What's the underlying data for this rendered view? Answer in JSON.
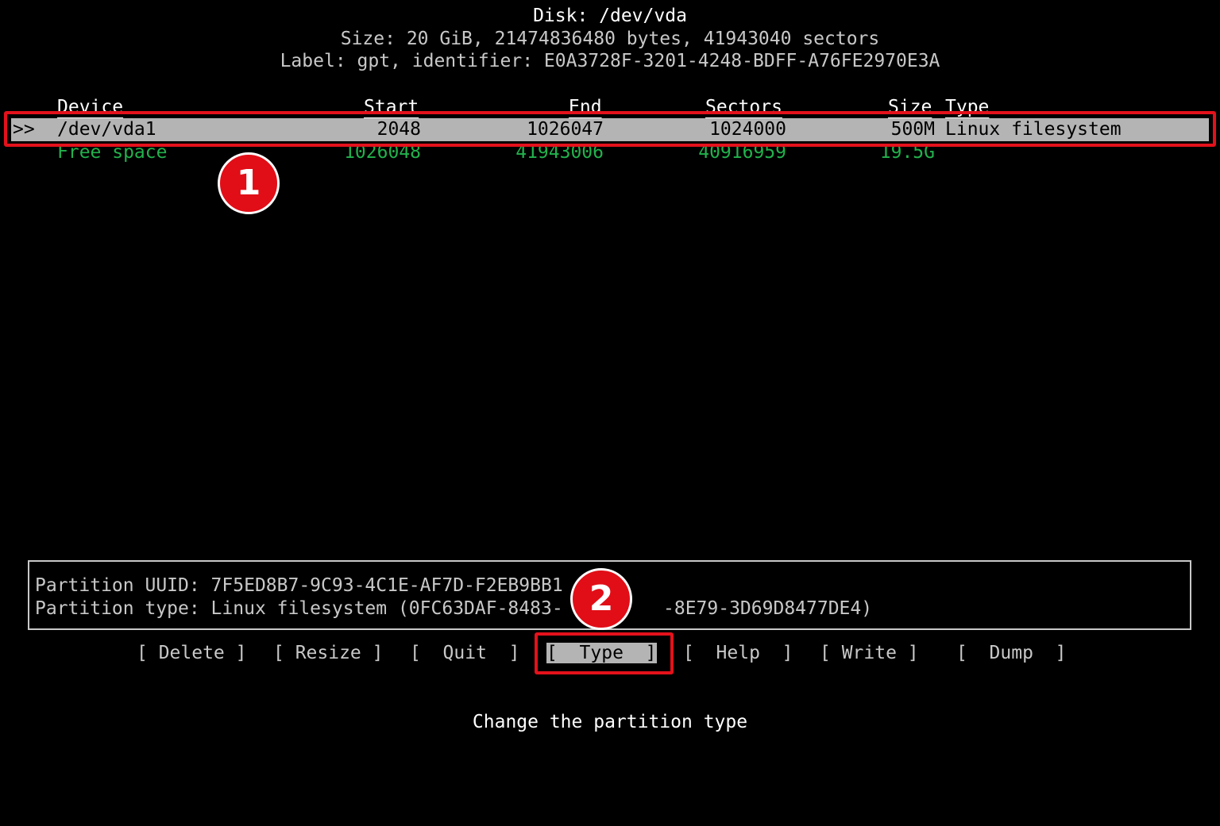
{
  "disk": {
    "title": "Disk: /dev/vda",
    "size_line": "Size: 20 GiB, 21474836480 bytes, 41943040 sectors",
    "label_line": "Label: gpt, identifier: E0A3728F-3201-4248-BDFF-A76FE2970E3A"
  },
  "table": {
    "headers": {
      "device": "Device",
      "start": "Start",
      "end": "End",
      "sectors": "Sectors",
      "size": "Size",
      "type": "Type"
    },
    "rows": [
      {
        "marker": ">>",
        "device": "/dev/vda1",
        "start": "2048",
        "end": "1026047",
        "sectors": "1024000",
        "size": "500M",
        "type": "Linux filesystem"
      },
      {
        "device": "Free space",
        "start": "1026048",
        "end": "41943006",
        "sectors": "40916959",
        "size": "19.5G"
      }
    ]
  },
  "info": {
    "uuid_line": "Partition UUID: 7F5ED8B7-9C93-4C1E-AF7D-F2EB9BB1",
    "type_line": "Partition type: Linux filesystem (0FC63DAF-8483-",
    "type_line_tail": "-8E79-3D69D8477DE4)"
  },
  "menu": {
    "delete": "[ Delete ]",
    "resize": "[ Resize ]",
    "quit": "[  Quit  ]",
    "type_open": "[",
    "type_label": "  Type  ",
    "type_close": "]",
    "help": "[  Help  ]",
    "write": "[ Write ]",
    "dump": "[  Dump  ]"
  },
  "status": "Change the partition type",
  "annotations": {
    "badge_1": "1",
    "badge_2": "2"
  },
  "colors": {
    "background": "#000000",
    "selected_row": "#b4b4b4",
    "free_space": "#22b14c",
    "highlight": "#e4111b"
  }
}
